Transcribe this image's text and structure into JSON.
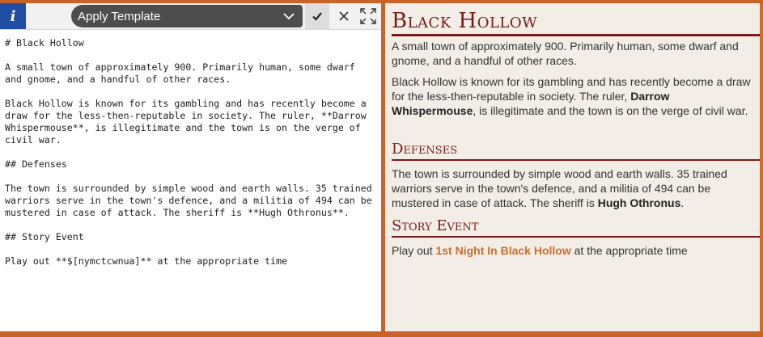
{
  "toolbar": {
    "info_label": "i",
    "template_select": "Apply Template"
  },
  "editor": {
    "markdown": "# Black Hollow\n\nA small town of approximately 900. Primarily human, some dwarf and gnome, and a handful of other races.\n\nBlack Hollow is known for its gambling and has recently become a draw for the less-then-reputable in society. The ruler, **Darrow Whispermouse**, is illegitimate and the town is on the verge of civil war.\n\n## Defenses\n\nThe town is surrounded by simple wood and earth walls. 35 trained warriors serve in the town's defence, and a militia of 494 can be mustered in case of attack. The sheriff is **Hugh Othronus**.\n\n## Story Event\n\nPlay out **$[nymctcwnua]** at the appropriate time"
  },
  "preview": {
    "title": "Black Hollow",
    "p1": "A small town of approximately 900. Primarily human, some dwarf and gnome, and a handful of other races.",
    "p2_a": "Black Hollow is known for its gambling and has recently become a draw for the less-then-reputable in society. The ruler, ",
    "p2_ruler": "Darrow Whispermouse",
    "p2_b": ", is illegitimate and the town is on the verge of civil war.",
    "defenses_heading": "Defenses",
    "def_a": "The town is surrounded by simple wood and earth walls. 35 trained warriors serve in the town's defence, and a militia of 494 can be mustered in case of attack. The sheriff is ",
    "def_sheriff": "Hugh Othronus",
    "def_b": ".",
    "story_heading": "Story Event",
    "story_a": "Play out ",
    "story_link": "1st Night In Black Hollow",
    "story_b": " at the appropriate time"
  },
  "colors": {
    "frame": "#c8632a",
    "heading": "#7a1a16",
    "info_button": "#1f4ea3",
    "link": "#d46a2a",
    "preview_bg": "#f2eee7"
  },
  "icons": {
    "chevron": "chevron-down-icon",
    "confirm": "check-icon",
    "cancel": "close-icon",
    "expand": "expand-icon"
  }
}
